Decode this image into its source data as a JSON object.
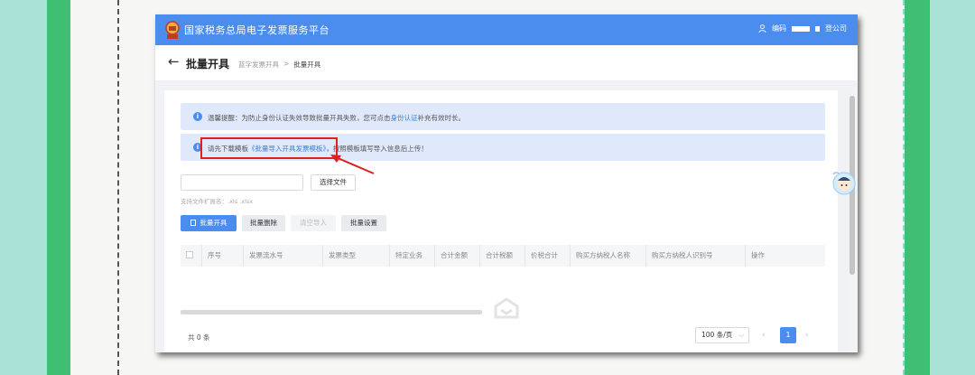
{
  "app": {
    "title": "国家税务总局电子发票服务平台"
  },
  "header": {
    "user_prefix": "编码",
    "logout": "登公司"
  },
  "page": {
    "back_symbol": "←",
    "title": "批量开具",
    "breadcrumb": {
      "parent": "蓝字发票开具",
      "separator": ">",
      "current": "批量开具"
    }
  },
  "notices": {
    "warm_tip": {
      "icon": "info-icon",
      "text_before": "温馨提醒：为防止身份认证失效导致批量开具失败，您可点击",
      "link": "身份认证",
      "text_after": "补充有效时长。"
    },
    "download": {
      "icon": "info-icon",
      "text_before": "请先下载模板",
      "link": "《批量导入开具发票模板》",
      "text_after": "，按照模板填写导入信息后上传！"
    }
  },
  "upload": {
    "choose_button": "选择文件",
    "ext_hint": "支持文件扩展名：.xls .xlsx"
  },
  "actions": {
    "batch_issue": "批量开具",
    "batch_delete": "批量删除",
    "clear_import": "清空导入",
    "batch_settings": "批量设置"
  },
  "table": {
    "columns": [
      "序号",
      "发票流水号",
      "发票类型",
      "特定业务",
      "合计金额",
      "合计税额",
      "价税合计",
      "购买方纳税人名称",
      "购买方纳税人识别号",
      "操作"
    ]
  },
  "pagination": {
    "total": "共 0 条",
    "page_size": "100 条/页",
    "prev": "‹",
    "current_page": "1",
    "next": "›"
  },
  "colors": {
    "brand_blue": "#4a8def",
    "notice_bg": "#dfe9fb",
    "highlight_red": "#e02020",
    "frame_green": "#3fbf73"
  }
}
